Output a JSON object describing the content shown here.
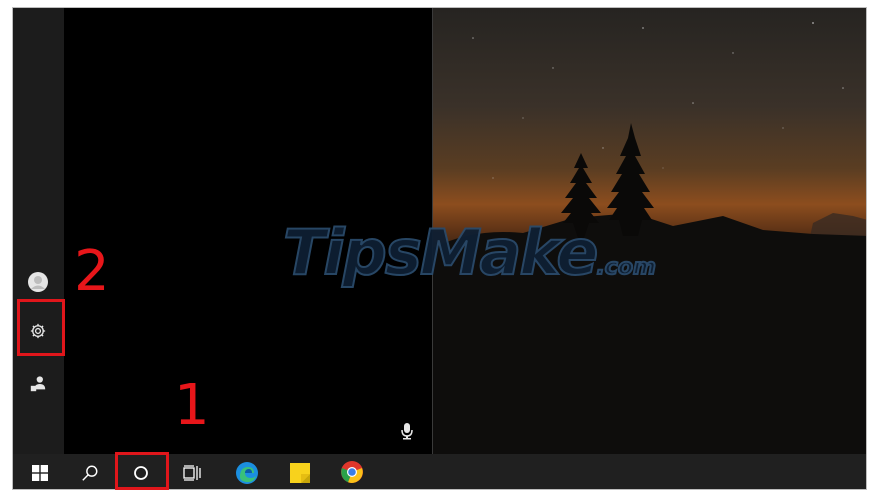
{
  "watermark": {
    "brand": "TipsMake",
    ".com": ".com"
  },
  "annotations": {
    "step1": "1",
    "step2": "2"
  },
  "rail": {
    "avatar_icon": "avatar-icon",
    "settings_icon": "gear-icon",
    "power_icon": "user-switch-icon"
  },
  "taskbar": {
    "items": [
      {
        "name": "start-button",
        "icon": "windows-logo-icon"
      },
      {
        "name": "search-button",
        "icon": "search-icon"
      },
      {
        "name": "cortana-button",
        "icon": "cortana-circle-icon"
      },
      {
        "name": "task-view-button",
        "icon": "task-view-icon"
      },
      {
        "name": "edge-button",
        "icon": "edge-icon"
      },
      {
        "name": "sticky-notes-button",
        "icon": "sticky-notes-icon"
      },
      {
        "name": "chrome-button",
        "icon": "chrome-icon"
      }
    ]
  },
  "colors": {
    "accent_red": "#e0161b",
    "taskbar": "#202020",
    "rail": "#1c1c1c"
  }
}
